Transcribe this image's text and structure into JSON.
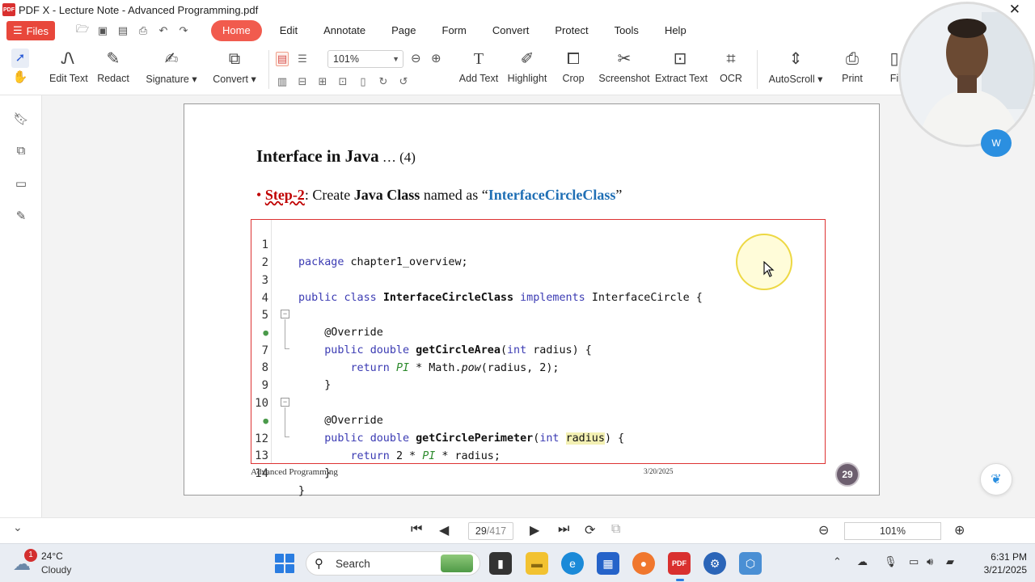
{
  "window": {
    "title": "PDF X - Lecture Note - Advanced Programming.pdf",
    "logo_text": "PDF",
    "close_glyph": "✕"
  },
  "menubar": {
    "files_label": "Files",
    "items": [
      "Home",
      "Edit",
      "Annotate",
      "Page",
      "Form",
      "Convert",
      "Protect",
      "Tools",
      "Help"
    ],
    "active_item": "Home"
  },
  "toolbar": {
    "tools": [
      {
        "label": "Edit Text",
        "icon": "edit-text-icon"
      },
      {
        "label": "Redact",
        "icon": "redact-icon"
      },
      {
        "label": "Signature ▾",
        "icon": "signature-icon"
      },
      {
        "label": "Convert ▾",
        "icon": "convert-icon"
      },
      {
        "label": "Add Text",
        "icon": "add-text-icon"
      },
      {
        "label": "Highlight",
        "icon": "highlight-icon"
      },
      {
        "label": "Crop",
        "icon": "crop-icon"
      },
      {
        "label": "Screenshot",
        "icon": "screenshot-icon"
      },
      {
        "label": "Extract Text",
        "icon": "extract-text-icon"
      },
      {
        "label": "OCR",
        "icon": "ocr-icon"
      },
      {
        "label": "AutoScroll ▾",
        "icon": "autoscroll-icon"
      },
      {
        "label": "Print",
        "icon": "print-icon"
      },
      {
        "label": "Fi",
        "icon": "find-icon"
      }
    ],
    "zoom_value": "101%"
  },
  "document": {
    "slide_title": "Interface in Java",
    "slide_title_suffix": " … (4)",
    "step": {
      "bullet": "•",
      "label": "Step-2",
      "text1": ": Create ",
      "bold1": "Java Class",
      "text2": " named as “",
      "class_name": "InterfaceCircleClass",
      "text3": "”"
    },
    "code_line_numbers": [
      "1",
      "2",
      "3",
      "4",
      "5",
      "●",
      "7",
      "8",
      "9",
      "10",
      "●",
      "12",
      "13",
      "14"
    ],
    "footer_left": "Advanced Programming",
    "footer_date": "3/20/2025",
    "page_badge": "29"
  },
  "navigation": {
    "current_page": "29",
    "total_pages": "/417",
    "zoom_value": "101%"
  },
  "taskbar": {
    "weather_temp": "24°C",
    "weather_cond": "Cloudy",
    "weather_badge": "1",
    "search_label": "Search",
    "time": "6:31 PM",
    "date": "3/21/2025"
  },
  "overlay": {
    "webcam_badge": "W"
  },
  "colors": {
    "accent": "#f15b4e",
    "files_button": "#e8473b",
    "code_border": "#dd3333",
    "keyword": "#3b3bb3",
    "title_blue": "#1f6fb5",
    "step_red": "#c00000"
  }
}
